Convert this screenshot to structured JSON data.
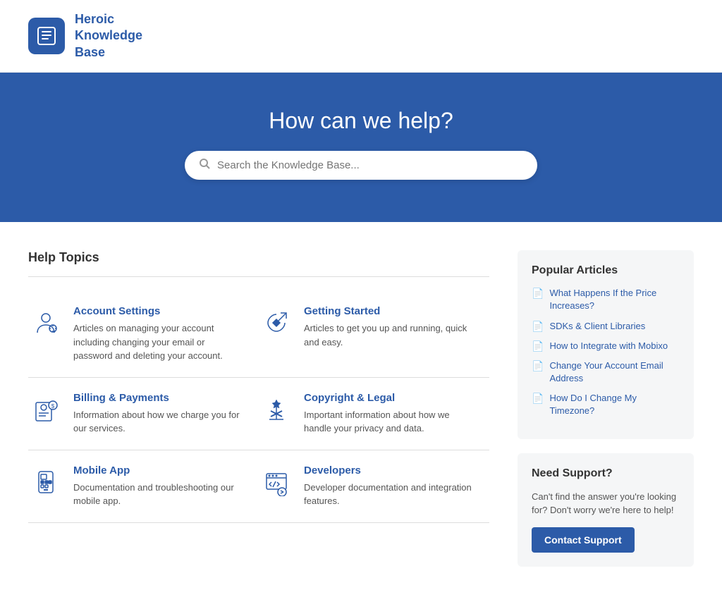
{
  "header": {
    "logo_icon": "📖",
    "brand_name": "Heroic\nKnowledge\nBase"
  },
  "hero": {
    "title": "How can we help?",
    "search_placeholder": "Search the Knowledge Base..."
  },
  "help_topics": {
    "section_title": "Help Topics",
    "topics": [
      {
        "id": "account-settings",
        "title": "Account Settings",
        "description": "Articles on managing your account including changing your email or password and deleting your account."
      },
      {
        "id": "getting-started",
        "title": "Getting Started",
        "description": "Articles to get you up and running, quick and easy."
      },
      {
        "id": "billing-payments",
        "title": "Billing & Payments",
        "description": "Information about how we charge you for our services."
      },
      {
        "id": "copyright-legal",
        "title": "Copyright & Legal",
        "description": "Important information about how we handle your privacy and data."
      },
      {
        "id": "mobile-app",
        "title": "Mobile App",
        "description": "Documentation and troubleshooting our mobile app."
      },
      {
        "id": "developers",
        "title": "Developers",
        "description": "Developer documentation and integration features."
      }
    ]
  },
  "sidebar": {
    "popular_articles": {
      "title": "Popular Articles",
      "articles": [
        "What Happens If the Price Increases?",
        "SDKs & Client Libraries",
        "How to Integrate with Mobixo",
        "Change Your Account Email Address",
        "How Do I Change My Timezone?"
      ]
    },
    "support": {
      "title": "Need Support?",
      "description": "Can't find the answer you're looking for? Don't worry we're here to help!",
      "button_label": "Contact Support"
    }
  }
}
